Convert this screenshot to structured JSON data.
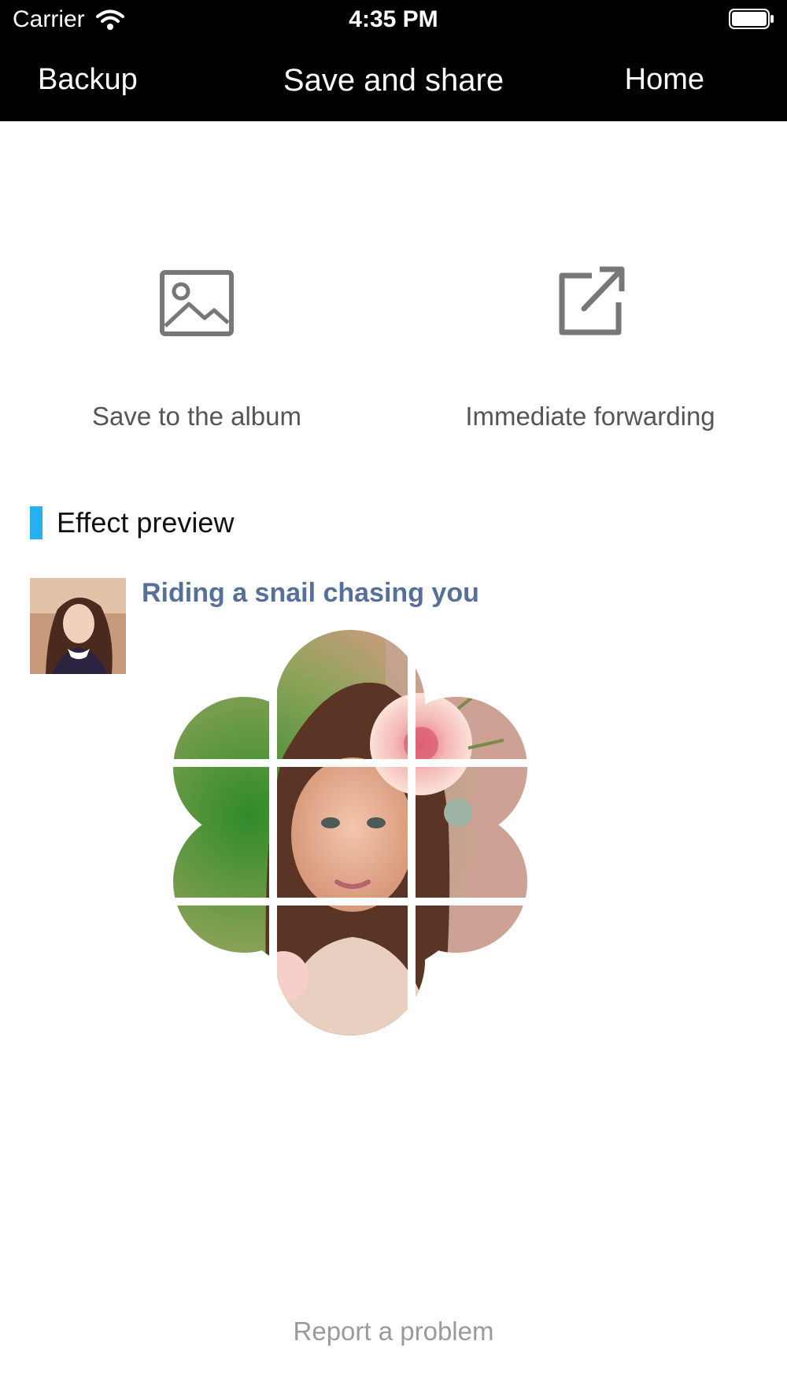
{
  "status": {
    "carrier": "Carrier",
    "time": "4:35 PM"
  },
  "nav": {
    "back": "Backup",
    "title": "Save and share",
    "home": "Home"
  },
  "actions": [
    {
      "label": "Save to the album",
      "icon": "image-icon"
    },
    {
      "label": "Immediate forwarding",
      "icon": "share-icon"
    }
  ],
  "section": {
    "title": "Effect preview"
  },
  "preview": {
    "title": "Riding a snail chasing you"
  },
  "footer": {
    "report": "Report a problem"
  },
  "colors": {
    "accent": "#28b1f0",
    "title_link": "#56709a",
    "nav_bg": "#000000"
  }
}
